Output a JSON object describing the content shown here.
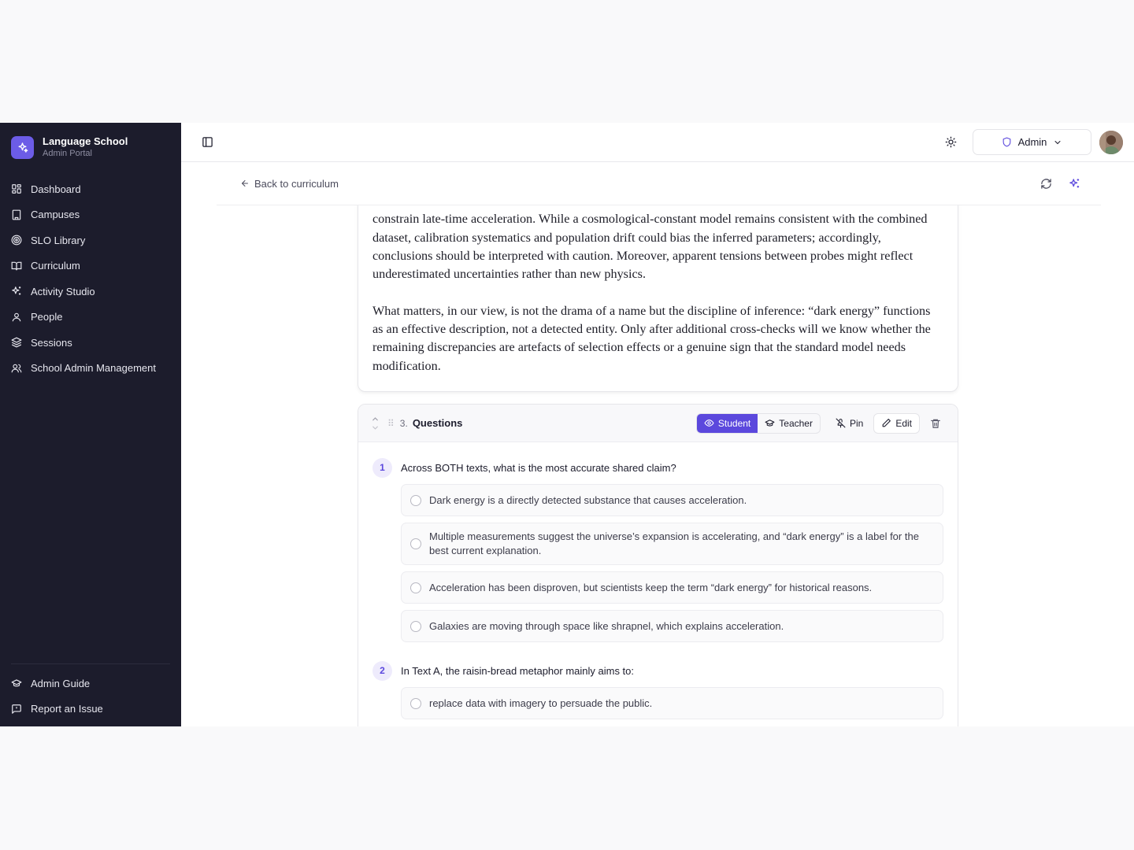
{
  "brand": {
    "title": "Language School",
    "subtitle": "Admin Portal"
  },
  "sidebar": {
    "items": [
      {
        "label": "Dashboard",
        "icon": "grid-icon"
      },
      {
        "label": "Campuses",
        "icon": "building-icon"
      },
      {
        "label": "SLO Library",
        "icon": "target-icon"
      },
      {
        "label": "Curriculum",
        "icon": "book-icon"
      },
      {
        "label": "Activity Studio",
        "icon": "sparkles-icon"
      },
      {
        "label": "People",
        "icon": "user-icon"
      },
      {
        "label": "Sessions",
        "icon": "layers-icon"
      },
      {
        "label": "School Admin Management",
        "icon": "users-icon"
      }
    ],
    "bottom": [
      {
        "label": "Admin Guide",
        "icon": "graduation-cap-icon"
      },
      {
        "label": "Report an Issue",
        "icon": "message-icon"
      }
    ]
  },
  "topbar": {
    "role_label": "Admin"
  },
  "subbar": {
    "back_label": "Back to curriculum"
  },
  "passage": {
    "paragraphs": [
      "constrain late-time acceleration. While a cosmological-constant model remains consistent with the combined dataset, calibration systematics and population drift could bias the inferred parameters; accordingly, conclusions should be interpreted with caution. Moreover, apparent tensions between probes might reflect underestimated uncertainties rather than new physics.",
      "What matters, in our view, is not the drama of a name but the discipline of inference: “dark energy” functions as an effective description, not a detected entity. Only after additional cross-checks will we know whether the remaining discrepancies are artefacts of selection effects or a genuine sign that the standard model needs modification."
    ]
  },
  "questions_section": {
    "number": "3.",
    "title": "Questions",
    "student_label": "Student",
    "teacher_label": "Teacher",
    "pin_label": "Pin",
    "edit_label": "Edit",
    "questions": [
      {
        "number": "1",
        "text": "Across BOTH texts, what is the most accurate shared claim?",
        "options": [
          "Dark energy is a directly detected substance that causes acceleration.",
          "Multiple measurements suggest the universe’s expansion is accelerating, and “dark energy” is a label for the best current explanation.",
          "Acceleration has been disproven, but scientists keep the term “dark energy” for historical reasons.",
          "Galaxies are moving through space like shrapnel, which explains acceleration."
        ]
      },
      {
        "number": "2",
        "text": "In Text A, the raisin-bread metaphor mainly aims to:",
        "options": [
          "replace data with imagery to persuade the public."
        ]
      }
    ]
  },
  "colors": {
    "accent": "#5b48dd",
    "sidebar_bg": "#1c1c2c",
    "brand_logo": "#6c5ce7"
  }
}
